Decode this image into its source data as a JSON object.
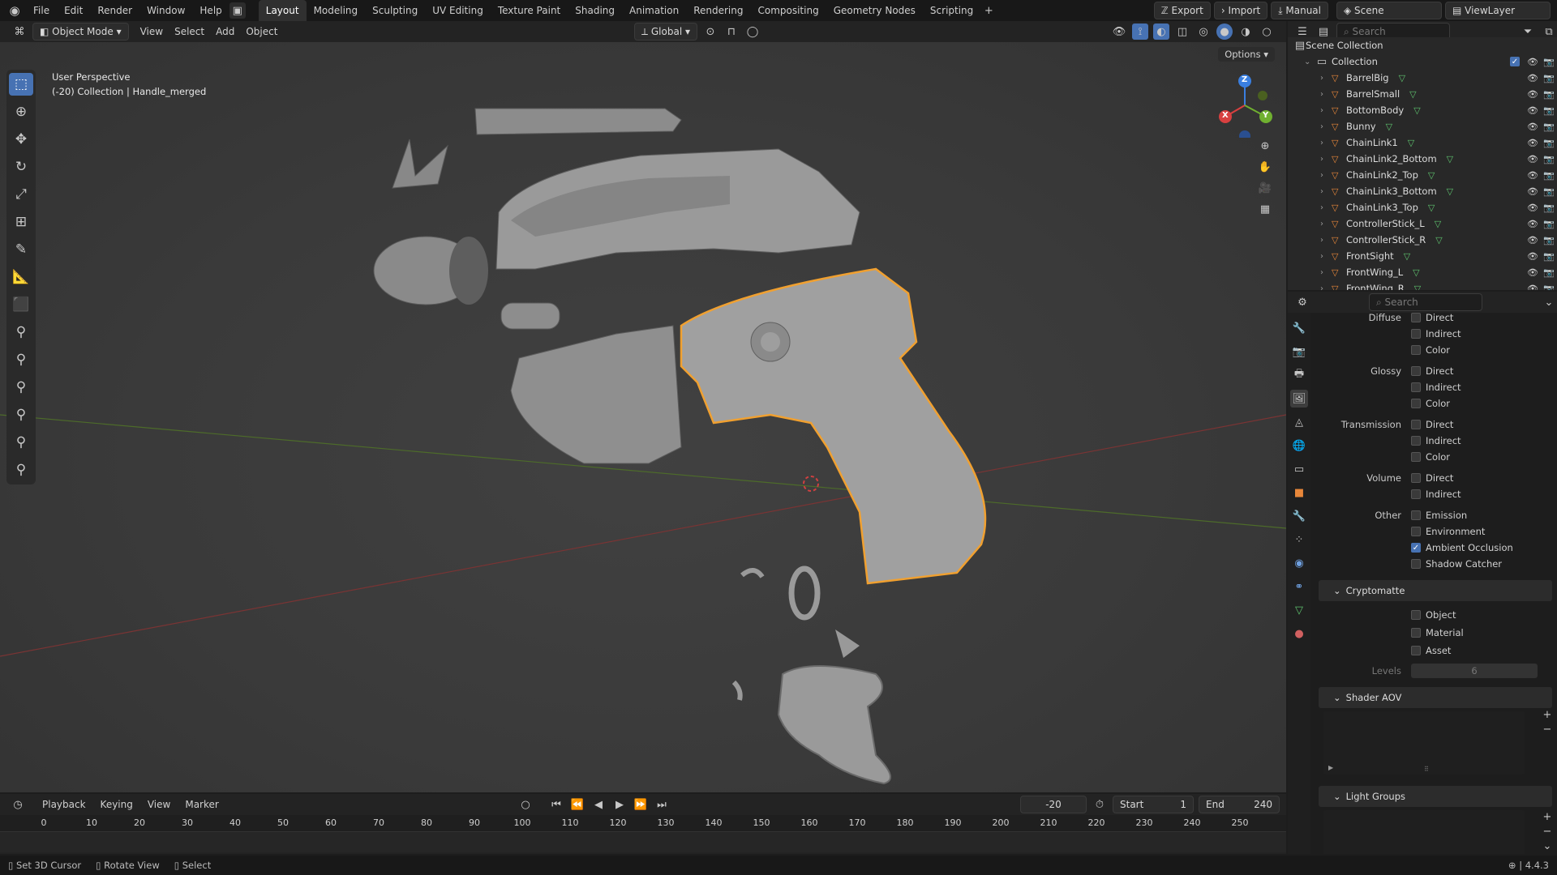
{
  "topbar": {
    "menu": [
      "File",
      "Edit",
      "Render",
      "Window",
      "Help"
    ],
    "workspaces": [
      "Layout",
      "Modeling",
      "Sculpting",
      "UV Editing",
      "Texture Paint",
      "Shading",
      "Animation",
      "Rendering",
      "Compositing",
      "Geometry Nodes",
      "Scripting"
    ],
    "active_workspace": "Layout",
    "export_label": "Export",
    "import_label": "Import",
    "manual_label": "Manual",
    "scene": "Scene",
    "view_layer": "ViewLayer"
  },
  "viewport_header": {
    "mode": "Object Mode",
    "menus": [
      "View",
      "Select",
      "Add",
      "Object"
    ],
    "orientation": "Global",
    "options_label": "Options"
  },
  "viewport": {
    "perspective": "User Perspective",
    "context": "(-20) Collection | Handle_merged",
    "gizmo": {
      "z": "Z",
      "x": "X",
      "y": "Y"
    }
  },
  "outliner": {
    "search_placeholder": "Search",
    "scene_collection": "Scene Collection",
    "collection": "Collection",
    "items": [
      "BarrelBig",
      "BarrelSmall",
      "BottomBody",
      "Bunny",
      "ChainLink1",
      "ChainLink2_Bottom",
      "ChainLink2_Top",
      "ChainLink3_Bottom",
      "ChainLink3_Top",
      "ControllerStick_L",
      "ControllerStick_R",
      "FrontSight",
      "FrontWing_L",
      "FrontWing_R"
    ]
  },
  "properties": {
    "search_placeholder": "Search",
    "passes": [
      {
        "label": "Diffuse",
        "items": [
          {
            "name": "Direct",
            "on": false
          },
          {
            "name": "Indirect",
            "on": false
          },
          {
            "name": "Color",
            "on": false
          }
        ]
      },
      {
        "label": "Glossy",
        "items": [
          {
            "name": "Direct",
            "on": false
          },
          {
            "name": "Indirect",
            "on": false
          },
          {
            "name": "Color",
            "on": false
          }
        ]
      },
      {
        "label": "Transmission",
        "items": [
          {
            "name": "Direct",
            "on": false
          },
          {
            "name": "Indirect",
            "on": false
          },
          {
            "name": "Color",
            "on": false
          }
        ]
      },
      {
        "label": "Volume",
        "items": [
          {
            "name": "Direct",
            "on": false
          },
          {
            "name": "Indirect",
            "on": false
          }
        ]
      },
      {
        "label": "Other",
        "items": [
          {
            "name": "Emission",
            "on": false
          },
          {
            "name": "Environment",
            "on": false
          },
          {
            "name": "Ambient Occlusion",
            "on": true
          },
          {
            "name": "Shadow Catcher",
            "on": false
          }
        ]
      }
    ],
    "cryptomatte": {
      "title": "Cryptomatte",
      "items": [
        "Object",
        "Material",
        "Asset"
      ],
      "levels_label": "Levels",
      "levels_value": "6"
    },
    "shader_aov": "Shader AOV",
    "light_groups": "Light Groups"
  },
  "timeline": {
    "menus": [
      "Playback",
      "Keying",
      "View",
      "Marker"
    ],
    "current_frame": "-20",
    "start_label": "Start",
    "start": "1",
    "end_label": "End",
    "end": "240",
    "ticks": [
      "0",
      "10",
      "20",
      "30",
      "40",
      "50",
      "60",
      "70",
      "80",
      "90",
      "100",
      "110",
      "120",
      "130",
      "140",
      "150",
      "160",
      "170",
      "180",
      "190",
      "200",
      "210",
      "220",
      "230",
      "240",
      "250"
    ]
  },
  "status": {
    "items": [
      "Set 3D Cursor",
      "Rotate View",
      "Select"
    ],
    "version": "4.4.3"
  },
  "colors": {
    "accent": "#4772b3",
    "selection": "#f0a030",
    "object_icon": "#e8873a",
    "mesh_icon": "#5ec26e"
  }
}
